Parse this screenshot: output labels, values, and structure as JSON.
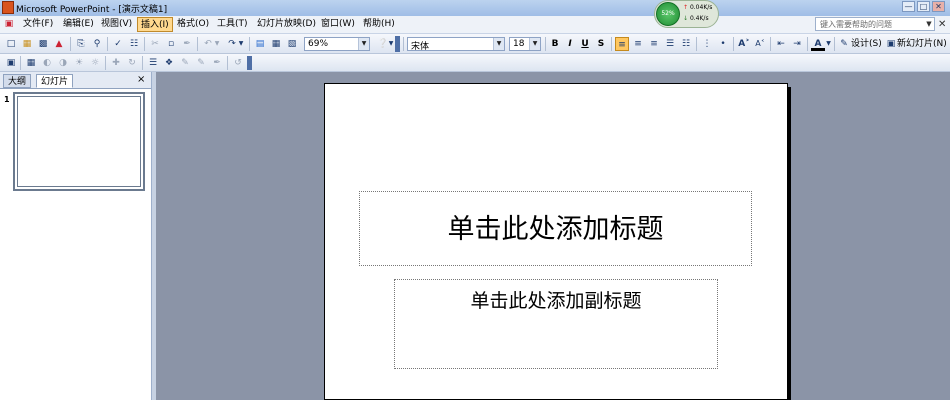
{
  "window": {
    "title": "Microsoft PowerPoint - [演示文稿1]",
    "min_glyph": "—",
    "max_glyph": "□",
    "close_glyph": "✕"
  },
  "menu": {
    "items": [
      "文件(F)",
      "编辑(E)",
      "视图(V)",
      "插入(I)",
      "格式(O)",
      "工具(T)",
      "幻灯片放映(D)",
      "窗口(W)",
      "帮助(H)"
    ],
    "active_index": 3,
    "help_placeholder": "键入需要帮助的问题",
    "close_glyph": "✕"
  },
  "net_widget": {
    "percent": "52%",
    "upload": "0.04K/s",
    "download": "0.4K/s",
    "up_arrow": "↑",
    "down_arrow": "↓"
  },
  "toolbar1": {
    "zoom": "69%",
    "font_name": "宋体",
    "font_size": "18",
    "bold": "B",
    "italic": "I",
    "underline": "U",
    "shadow": "S",
    "design_label": "设计(S)",
    "new_slide_label": "新幻灯片(N)"
  },
  "left_pane": {
    "tab_outline": "大纲",
    "tab_slides": "幻灯片",
    "close_glyph": "×",
    "slide_number": "1"
  },
  "slide": {
    "title_placeholder": "单击此处添加标题",
    "subtitle_placeholder": "单击此处添加副标题"
  },
  "colors": {
    "workspace_bg": "#8b94a7",
    "menu_active_bg": "#ffd98f",
    "titlebar": "#9fbde6"
  }
}
